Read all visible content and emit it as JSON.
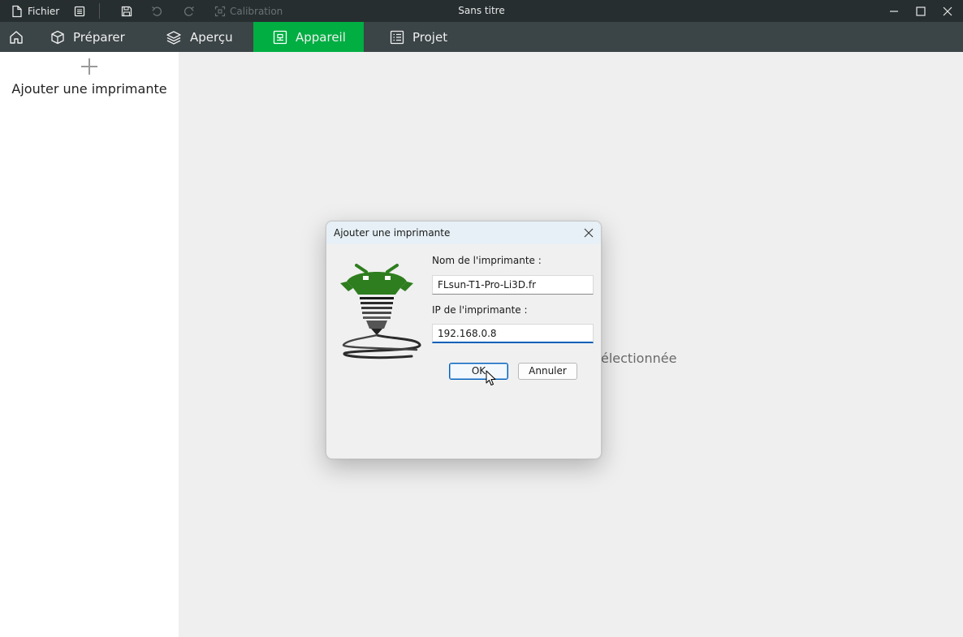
{
  "titlebar": {
    "file_label": "Fichier",
    "calibration_label": "Calibration",
    "window_title": "Sans titre"
  },
  "nav": {
    "tabs": [
      {
        "label": "Préparer",
        "icon": "cube-icon"
      },
      {
        "label": "Aperçu",
        "icon": "layers-icon"
      },
      {
        "label": "Appareil",
        "icon": "device-icon",
        "active": true
      },
      {
        "label": "Projet",
        "icon": "list-icon"
      }
    ]
  },
  "sidebar": {
    "add_printer_label": "Ajouter une imprimante"
  },
  "main": {
    "message": "électionnée"
  },
  "dialog": {
    "title": "Ajouter une imprimante",
    "name_label": "Nom de l'imprimante :",
    "name_value": "FLsun-T1-Pro-Li3D.fr",
    "ip_label": "IP de l'imprimante :",
    "ip_value": "192.168.0.8",
    "ok_label": "OK",
    "cancel_label": "Annuler"
  },
  "colors": {
    "accent_green": "#00ae42",
    "titlebar": "#262e30",
    "navbar": "#3b4446",
    "logo_green": "#2e7d1e"
  }
}
